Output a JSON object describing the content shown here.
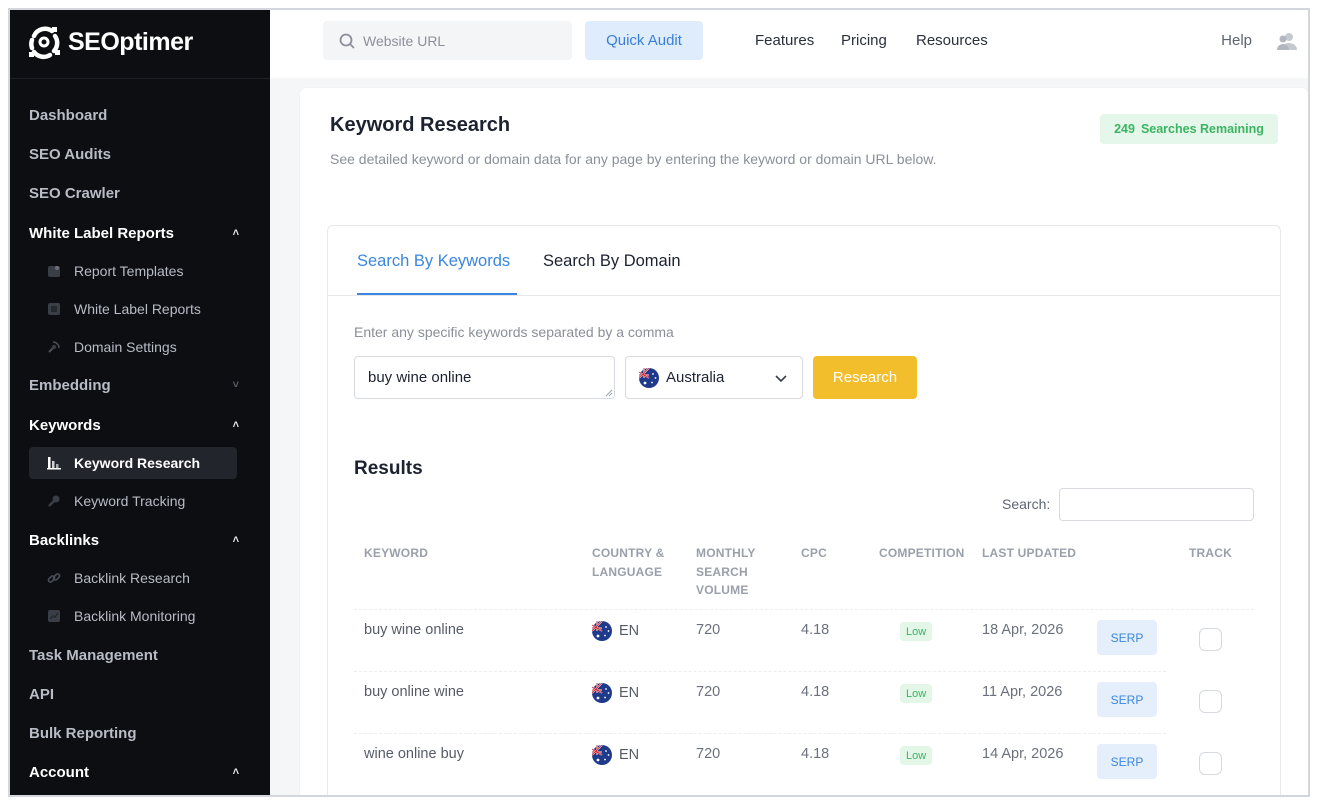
{
  "brand": {
    "name": "SEOptimer"
  },
  "topbar": {
    "url_placeholder": "Website URL",
    "quick_audit": "Quick Audit",
    "links": [
      "Features",
      "Pricing",
      "Resources"
    ],
    "help": "Help"
  },
  "sidebar": {
    "dashboard": "Dashboard",
    "seo_audits": "SEO Audits",
    "seo_crawler": "SEO Crawler",
    "white_label_reports": "White Label Reports",
    "report_templates": "Report Templates",
    "white_label_reports_sub": "White Label Reports",
    "domain_settings": "Domain Settings",
    "embedding": "Embedding",
    "keywords": "Keywords",
    "keyword_research": "Keyword Research",
    "keyword_tracking": "Keyword Tracking",
    "backlinks": "Backlinks",
    "backlink_research": "Backlink Research",
    "backlink_monitoring": "Backlink Monitoring",
    "task_management": "Task Management",
    "api": "API",
    "bulk_reporting": "Bulk Reporting",
    "account": "Account"
  },
  "page": {
    "title": "Keyword Research",
    "subtitle": "See detailed keyword or domain data for any page by entering the keyword or domain URL below.",
    "remaining_count": "249",
    "remaining_label": "Searches Remaining"
  },
  "tabs": {
    "keywords": "Search By Keywords",
    "domain": "Search By Domain"
  },
  "form": {
    "hint": "Enter any specific keywords separated by a comma",
    "keyword_value": "buy wine online",
    "country": "Australia",
    "research": "Research"
  },
  "results": {
    "title": "Results",
    "search_label": "Search:",
    "headers": {
      "keyword": "KEYWORD",
      "country_1": "COUNTRY &",
      "country_2": "LANGUAGE",
      "volume_1": "MONTHLY",
      "volume_2": "SEARCH",
      "volume_3": "VOLUME",
      "cpc": "CPC",
      "competition": "COMPETITION",
      "updated": "LAST UPDATED",
      "track": "TRACK"
    },
    "rows": [
      {
        "keyword": "buy wine online",
        "lang": "EN",
        "volume": "720",
        "cpc": "4.18",
        "competition": "Low",
        "updated": "18 Apr, 2026",
        "serp": "SERP"
      },
      {
        "keyword": "buy online wine",
        "lang": "EN",
        "volume": "720",
        "cpc": "4.18",
        "competition": "Low",
        "updated": "11 Apr, 2026",
        "serp": "SERP"
      },
      {
        "keyword": "wine online buy",
        "lang": "EN",
        "volume": "720",
        "cpc": "4.18",
        "competition": "Low",
        "updated": "14 Apr, 2026",
        "serp": "SERP"
      }
    ]
  }
}
